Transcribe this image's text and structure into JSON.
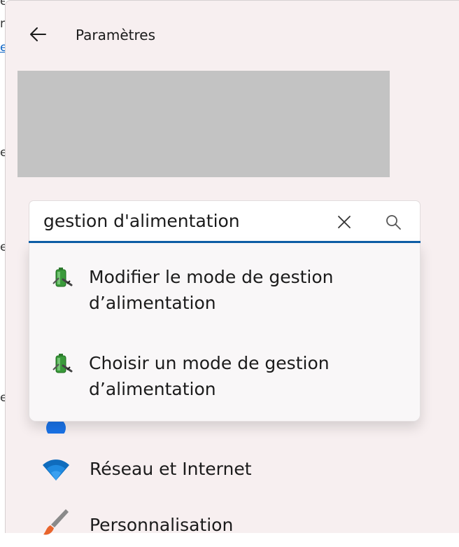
{
  "window": {
    "title": "Paramètres"
  },
  "search": {
    "value": "gestion d'alimentation"
  },
  "suggestions": [
    {
      "label": "Modifier le mode de gestion d’alimentation",
      "icon": "battery-plug-icon"
    },
    {
      "label": "Choisir un mode de gestion d’alimentation",
      "icon": "battery-plug-icon"
    }
  ],
  "nav": {
    "items": [
      {
        "label": "Réseau et Internet",
        "icon": "wifi-icon"
      },
      {
        "label": "Personnalisation",
        "icon": "paintbrush-icon"
      }
    ]
  },
  "colors": {
    "accent": "#0e5fa8",
    "window_bg": "#f7eff0",
    "placeholder_block": "#c3c3c3"
  }
}
